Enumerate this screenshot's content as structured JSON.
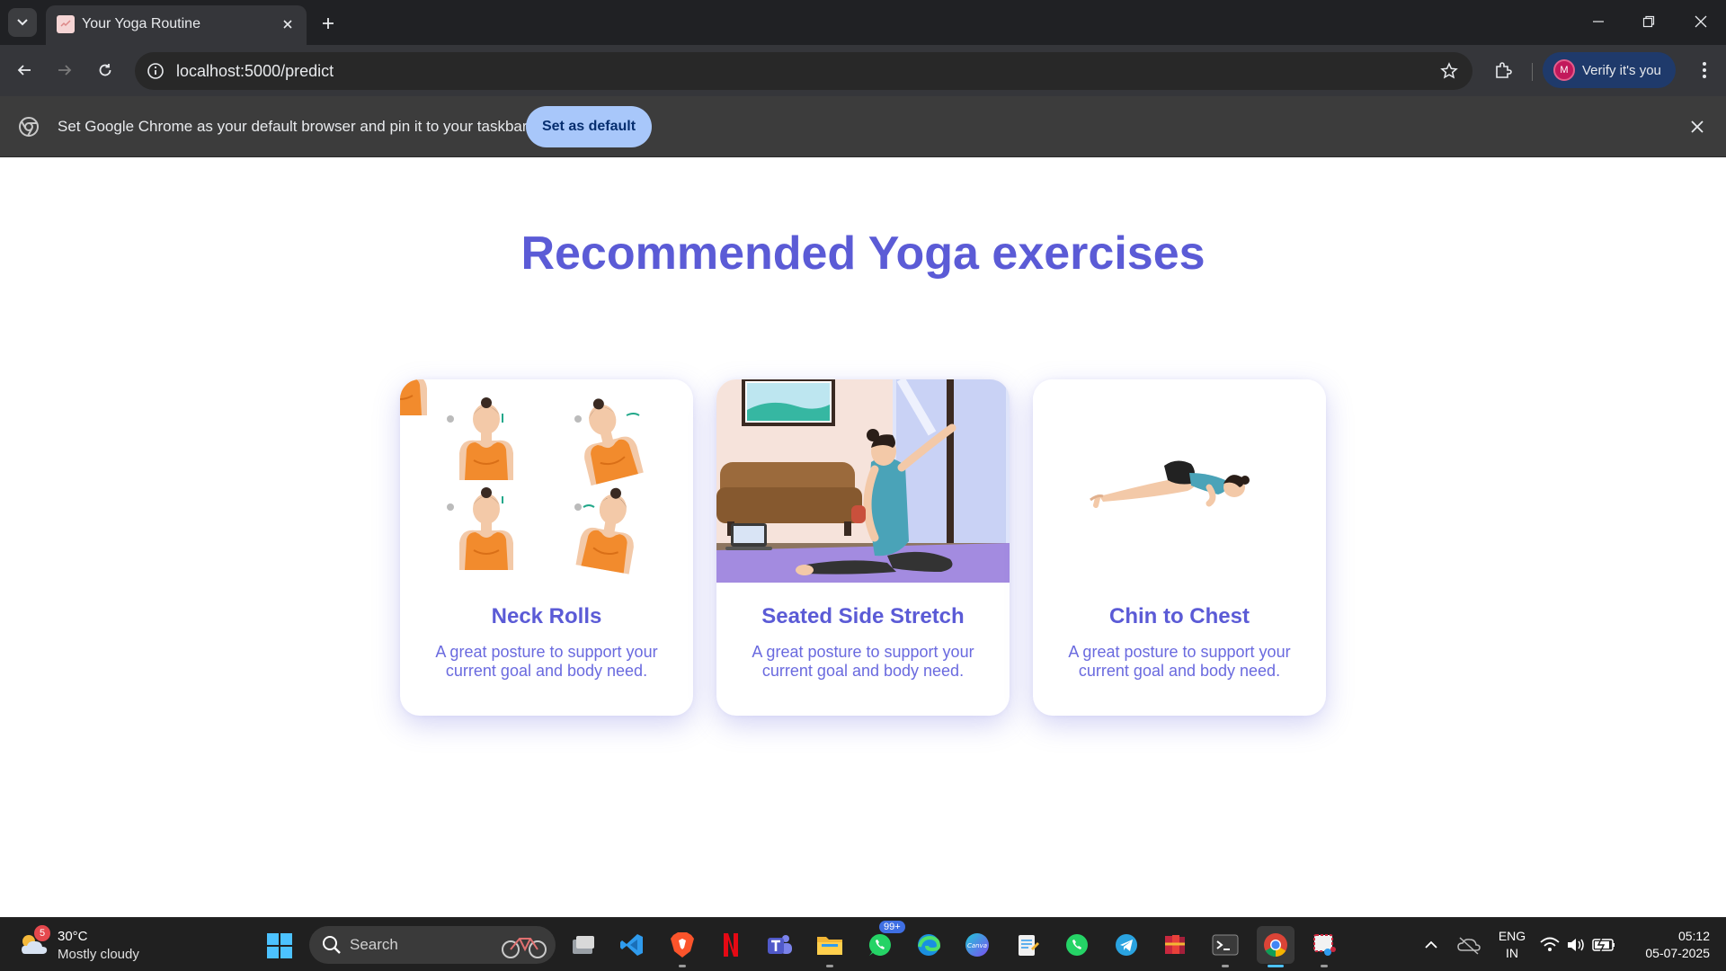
{
  "browser": {
    "tab": {
      "title": "Your Yoga Routine"
    },
    "address_bar": {
      "url": "localhost:5000/predict"
    },
    "profile": {
      "initial": "M",
      "label": "Verify it's you"
    },
    "infobar": {
      "message": "Set Google Chrome as your default browser and pin it to your taskbar",
      "button_label": "Set as default"
    }
  },
  "page": {
    "title": "Recommended Yoga exercises",
    "cards": [
      {
        "title": "Neck Rolls",
        "description": "A great posture to support your current goal and body need.",
        "image": "neck-rolls-illustration"
      },
      {
        "title": "Seated Side Stretch",
        "description": "A great posture to support your current goal and body need.",
        "image": "seated-side-stretch-illustration"
      },
      {
        "title": "Chin to Chest",
        "description": "A great posture to support your current goal and body need.",
        "image": "chin-to-chest-illustration"
      }
    ],
    "colors": {
      "accent": "#5b5bd6",
      "text": "#6a6adf"
    }
  },
  "taskbar": {
    "weather": {
      "temperature": "30°C",
      "condition": "Mostly cloudy",
      "badge": "5"
    },
    "search_placeholder": "Search",
    "whatsapp_badge": "99+",
    "canva_label": "Canva",
    "language": {
      "line1": "ENG",
      "line2": "IN"
    },
    "clock": {
      "time": "05:12",
      "date": "05-07-2025"
    }
  }
}
